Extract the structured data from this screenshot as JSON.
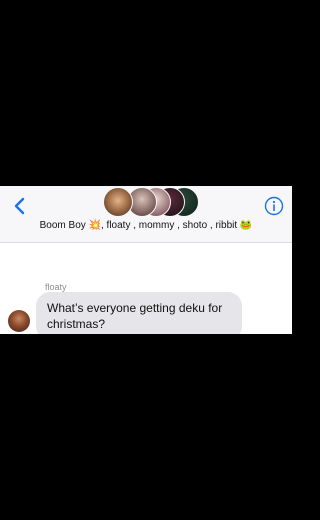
{
  "conversation": {
    "title": "Boom Boy 💥, floaty , mommy , shoto , ribbit 🐸",
    "participant_count": 5
  },
  "header": {
    "back_icon": "chevron-left-icon",
    "info_icon": "info-icon",
    "accent": "#1a73e8"
  },
  "messages": [
    {
      "sender": "floaty",
      "text": "What’s everyone getting deku for christmas?"
    }
  ]
}
